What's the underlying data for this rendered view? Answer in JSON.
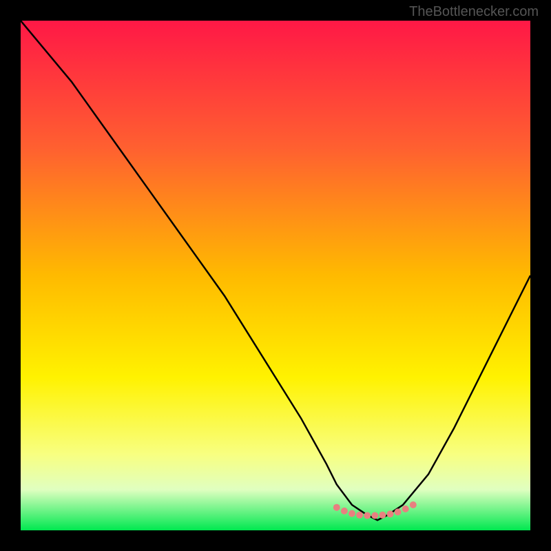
{
  "watermark": "TheBottlenecker.com",
  "chart_data": {
    "type": "line",
    "title": "",
    "xlabel": "",
    "ylabel": "",
    "xlim": [
      0,
      100
    ],
    "ylim": [
      0,
      100
    ],
    "series": [
      {
        "name": "curve",
        "x": [
          0,
          5,
          10,
          15,
          20,
          25,
          30,
          35,
          40,
          45,
          50,
          55,
          60,
          62,
          65,
          68,
          70,
          72,
          75,
          80,
          85,
          90,
          95,
          100
        ],
        "y": [
          100,
          94,
          88,
          81,
          74,
          67,
          60,
          53,
          46,
          38,
          30,
          22,
          13,
          9,
          5,
          3,
          2,
          3,
          5,
          11,
          20,
          30,
          40,
          50
        ]
      }
    ],
    "markers": {
      "x": [
        62,
        63.5,
        65,
        66.5,
        68,
        69.5,
        71,
        72.5,
        74,
        75.5,
        77
      ],
      "y": [
        4.5,
        3.8,
        3.3,
        3.0,
        2.9,
        2.9,
        3.0,
        3.2,
        3.6,
        4.2,
        5.0
      ]
    },
    "gradient_stops": [
      {
        "offset": 0,
        "color": "#ff1846"
      },
      {
        "offset": 25,
        "color": "#ff6030"
      },
      {
        "offset": 50,
        "color": "#ffba00"
      },
      {
        "offset": 70,
        "color": "#fff200"
      },
      {
        "offset": 85,
        "color": "#f8ff80"
      },
      {
        "offset": 92,
        "color": "#e0ffc0"
      },
      {
        "offset": 100,
        "color": "#00e850"
      }
    ],
    "curve_color": "#000000",
    "marker_color": "#e88080",
    "marker_radius": 5
  }
}
